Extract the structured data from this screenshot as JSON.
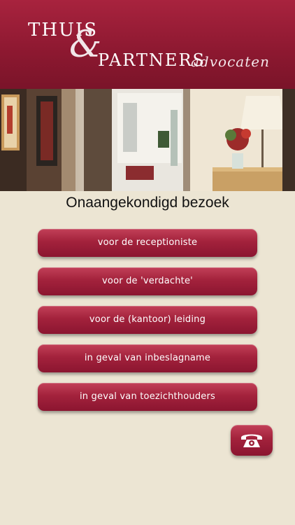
{
  "header": {
    "logo_line1": "THUIS",
    "logo_amp": "&",
    "logo_line2": "PARTNERS",
    "logo_line3": "advocaten"
  },
  "page_title": "Onaangekondigd bezoek",
  "buttons": [
    {
      "label": "voor de receptioniste"
    },
    {
      "label": "voor de 'verdachte'"
    },
    {
      "label": "voor de (kantoor) leiding"
    },
    {
      "label": "in geval van inbeslagname"
    },
    {
      "label": "in geval van toezichthouders"
    }
  ],
  "call_icon": "phone-icon",
  "colors": {
    "brand": "#8c1830",
    "background": "#ece5d3",
    "button_text": "#ffffff"
  }
}
